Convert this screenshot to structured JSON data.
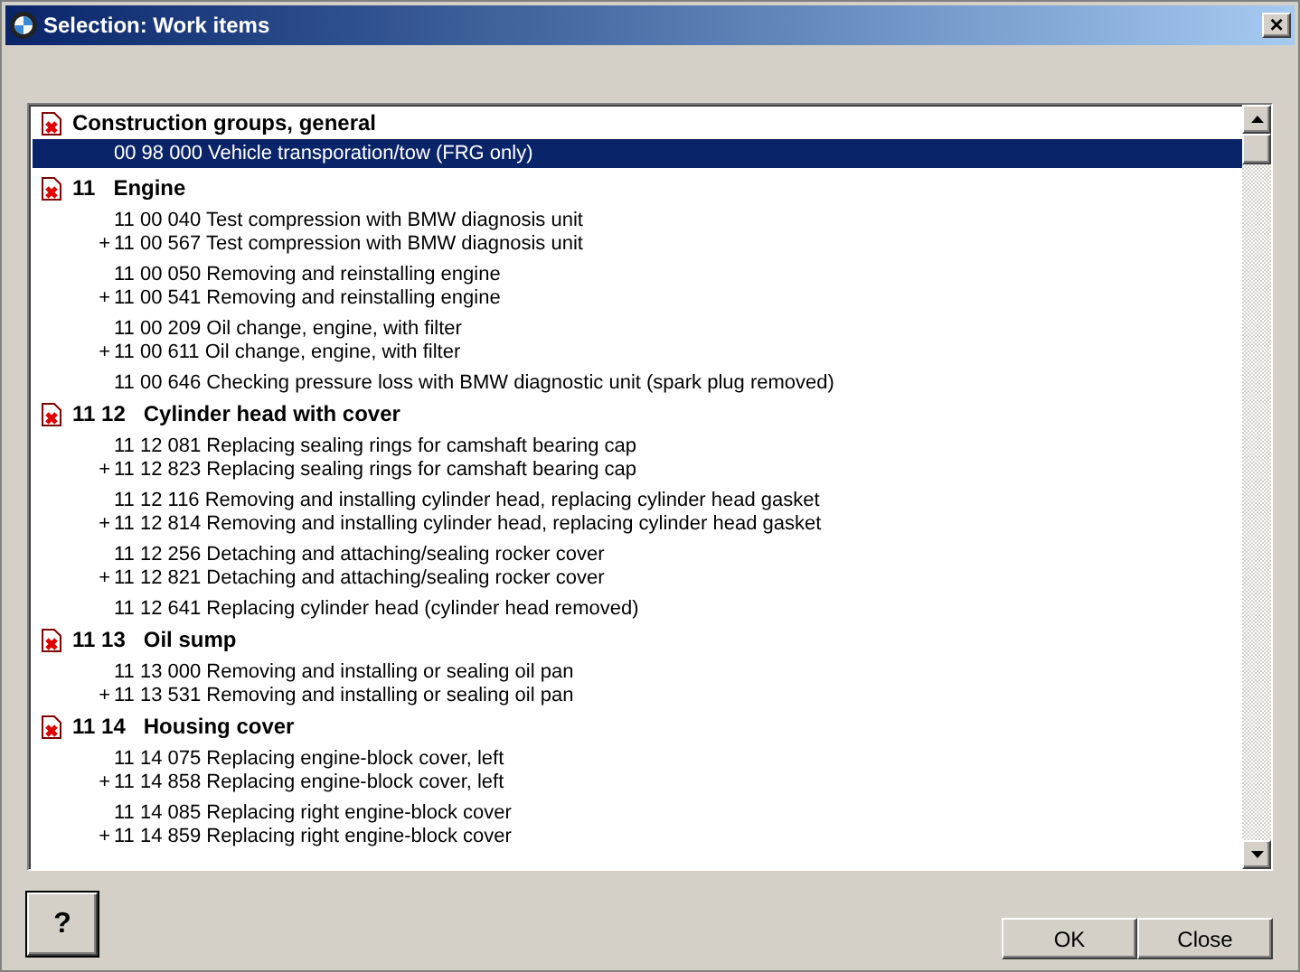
{
  "window": {
    "title": "Selection: Work items",
    "close": "×"
  },
  "groups": [
    {
      "title": "Construction groups, general",
      "clusters": [
        [
          {
            "text": "00 98 000 Vehicle transporation/tow (FRG only)",
            "selected": true
          }
        ]
      ]
    },
    {
      "code": "11",
      "title": "Engine",
      "clusters": [
        [
          {
            "text": "11 00 040 Test compression with BMW diagnosis unit",
            "selected": false
          },
          {
            "marker": "+",
            "text": "11 00 567 Test compression with BMW diagnosis unit",
            "selected": false
          }
        ],
        [
          {
            "text": "11 00 050 Removing and reinstalling engine",
            "selected": false
          },
          {
            "marker": "+",
            "text": "11 00 541 Removing and reinstalling engine",
            "selected": false
          }
        ],
        [
          {
            "text": "11 00 209 Oil change, engine, with filter",
            "selected": false
          },
          {
            "marker": "+",
            "text": "11 00 611 Oil change, engine, with filter",
            "selected": false
          }
        ],
        [
          {
            "text": "11 00 646 Checking pressure loss with BMW diagnostic unit (spark plug removed)",
            "selected": false
          }
        ]
      ]
    },
    {
      "code": "11 12",
      "title": "Cylinder head with cover",
      "clusters": [
        [
          {
            "text": "11 12 081 Replacing sealing rings for camshaft bearing cap",
            "selected": false
          },
          {
            "marker": "+",
            "text": "11 12 823 Replacing sealing rings for camshaft bearing cap",
            "selected": false
          }
        ],
        [
          {
            "text": "11 12 116 Removing and installing cylinder head, replacing cylinder head gasket",
            "selected": false
          },
          {
            "marker": "+",
            "text": "11 12 814 Removing and installing cylinder head, replacing cylinder head gasket",
            "selected": false
          }
        ],
        [
          {
            "text": "11 12 256 Detaching and attaching/sealing rocker cover",
            "selected": false
          },
          {
            "marker": "+",
            "text": "11 12 821 Detaching and attaching/sealing rocker cover",
            "selected": false
          }
        ],
        [
          {
            "text": "11 12 641 Replacing cylinder head (cylinder head removed)",
            "selected": false
          }
        ]
      ]
    },
    {
      "code": "11 13",
      "title": "Oil sump",
      "clusters": [
        [
          {
            "text": "11 13 000 Removing and installing or sealing oil pan",
            "selected": false
          },
          {
            "marker": "+",
            "text": "11 13 531 Removing and installing or sealing oil pan",
            "selected": false
          }
        ]
      ]
    },
    {
      "code": "11 14",
      "title": "Housing cover",
      "clusters": [
        [
          {
            "text": "11 14 075 Replacing engine-block cover, left",
            "selected": false
          },
          {
            "marker": "+",
            "text": "11 14 858 Replacing engine-block cover, left",
            "selected": false
          }
        ],
        [
          {
            "text": "11 14 085 Replacing right engine-block cover",
            "selected": false
          },
          {
            "marker": "+",
            "text": "11 14 859 Replacing right engine-block cover",
            "selected": false
          }
        ]
      ]
    }
  ],
  "buttons": {
    "help": "?",
    "ok": "OK",
    "close": "Close"
  }
}
